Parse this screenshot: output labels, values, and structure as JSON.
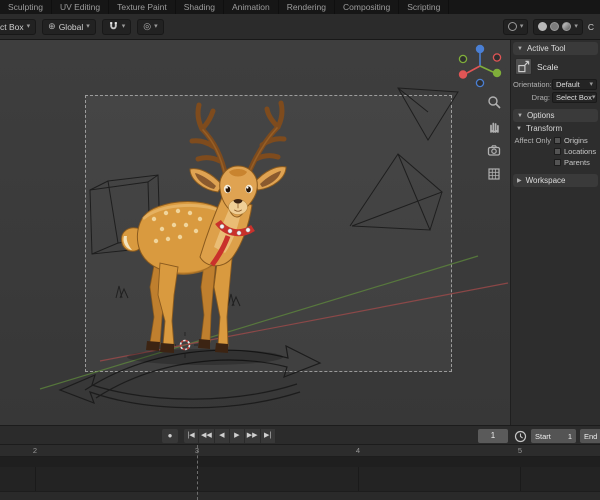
{
  "topbar": {
    "tabs": [
      "Sculpting",
      "UV Editing",
      "Texture Paint",
      "Shading",
      "Animation",
      "Rendering",
      "Compositing",
      "Scripting"
    ]
  },
  "tool_header": {
    "select_tool": "ct Box",
    "orientation": "Global",
    "right_text": "C"
  },
  "sidebar": {
    "active_tool_title": "Active Tool",
    "tool_name": "Scale",
    "orientation_label": "Orientation:",
    "orientation_value": "Default",
    "drag_label": "Drag:",
    "drag_value": "Select Box",
    "options_title": "Options",
    "transform_title": "Transform",
    "affect_only_label": "Affect Only",
    "affect_origins": "Origins",
    "affect_locations": "Locations",
    "affect_parents": "Parents",
    "workspace_title": "Workspace"
  },
  "timeline": {
    "transport": [
      "|◀",
      "◀◀",
      "◀",
      "▶",
      "▶▶",
      "▶|"
    ],
    "current_frame": "1",
    "start_label": "Start",
    "start_value": "1",
    "end_label": "End"
  },
  "dopesheet": {
    "frames": [
      "2",
      "3",
      "4",
      "5"
    ]
  },
  "icons": {
    "caret_down": "▾",
    "panel_open": "▼",
    "panel_closed": "▶",
    "globe": "⊕",
    "proportional": "◎",
    "record": "●"
  },
  "colors": {
    "gizmo_x": "#e05555",
    "gizmo_y": "#7fae3a",
    "gizmo_z": "#4a7fd4",
    "axis_x_line": "#9e4a4a",
    "axis_y_line": "#5f8a3c",
    "collar_red": "#c9312b",
    "deer_body": "#d99a3f"
  }
}
